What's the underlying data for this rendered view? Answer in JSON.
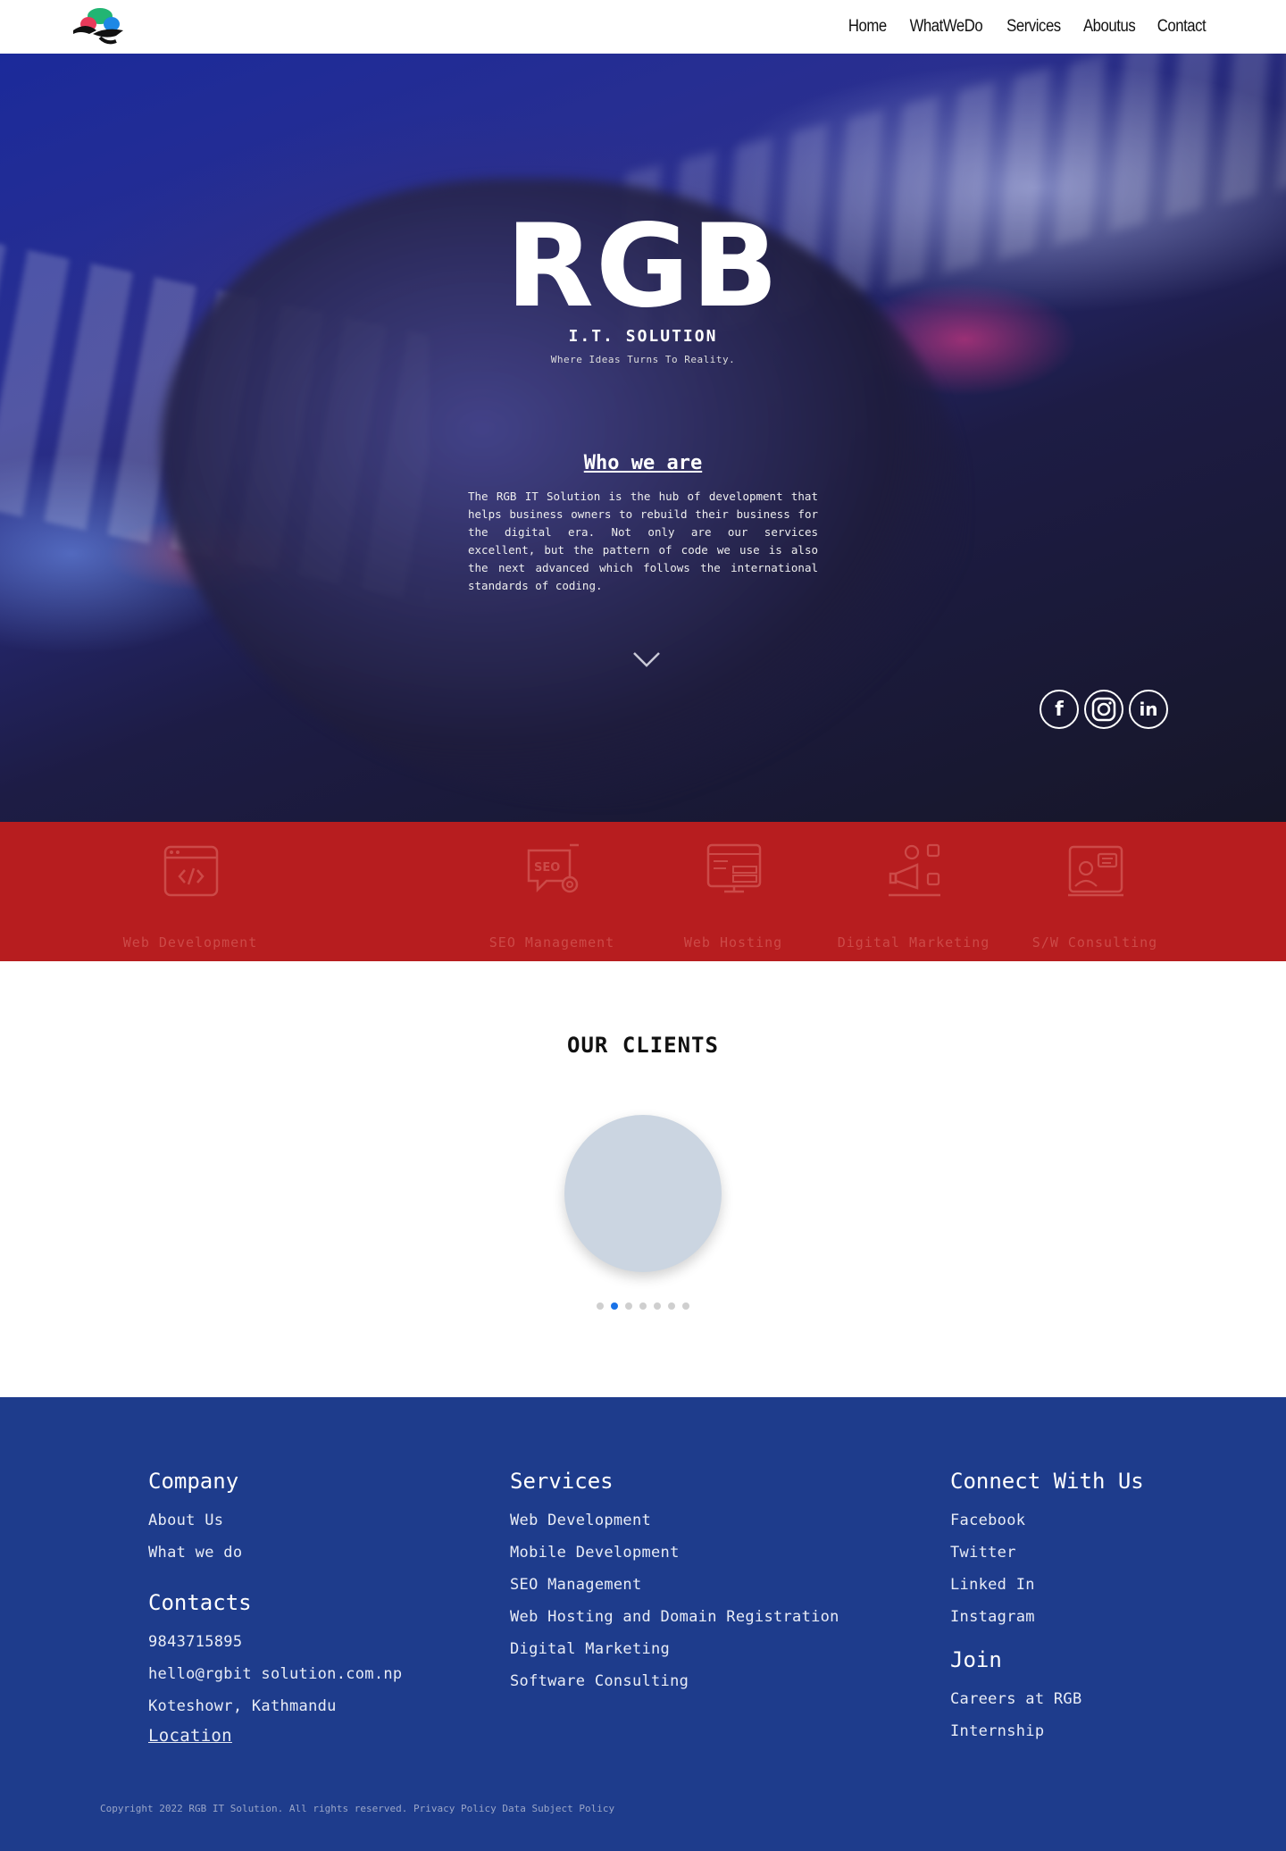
{
  "nav": {
    "links": [
      "Home",
      "WhatWeDo",
      "Services",
      "Aboutus",
      "Contact"
    ]
  },
  "hero": {
    "title": "RGB",
    "subtitle": "I.T. SOLUTION",
    "tagline": "Where Ideas Turns To Reality.",
    "who_title": "Who we are",
    "who_text": "The RGB IT Solution is the hub of development that helps business owners to rebuild their business for the digital era. Not only are our services excellent, but the pattern of code we use is also the next advanced which follows the international standards of coding."
  },
  "social_icons": [
    "facebook-icon",
    "instagram-icon",
    "linkedin-icon"
  ],
  "services": [
    {
      "label": "Web Development",
      "icon": "code-window-icon"
    },
    {
      "label": "SEO Management",
      "icon": "seo-gear-icon"
    },
    {
      "label": "Web Hosting",
      "icon": "server-icon"
    },
    {
      "label": "Digital Marketing",
      "icon": "megaphone-icon"
    },
    {
      "label": "S/W Consulting",
      "icon": "consultant-icon"
    }
  ],
  "clients": {
    "title": "OUR CLIENTS",
    "slide_count": 7,
    "active_slide": 2
  },
  "footer": {
    "company": {
      "heading": "Company",
      "links": [
        "About Us",
        "What we do"
      ]
    },
    "contacts": {
      "heading": "Contacts",
      "phone": "9843715895",
      "email": "hello@rgbit solution.com.np",
      "address": "Koteshowr, Kathmandu",
      "location_link": "Location"
    },
    "services": {
      "heading": "Services",
      "links": [
        "Web Development",
        "Mobile Development",
        "SEO Management",
        "Web Hosting and Domain Registration",
        "Digital Marketing",
        "Software Consulting"
      ]
    },
    "connect": {
      "heading": "Connect With Us",
      "links": [
        "Facebook",
        "Twitter",
        "Linked In",
        "Instagram"
      ]
    },
    "join": {
      "heading": "Join",
      "links": [
        "Careers at RGB",
        "Internship"
      ]
    },
    "copyright": "Copyright 2022 RGB IT Solution. All rights reserved. Privacy Policy Data Subject Policy"
  },
  "colors": {
    "services_band": "#b71d1f",
    "footer_bg": "#1e3c8c",
    "dot_active": "#1a73e8",
    "client_placeholder": "#cbd5e1"
  }
}
